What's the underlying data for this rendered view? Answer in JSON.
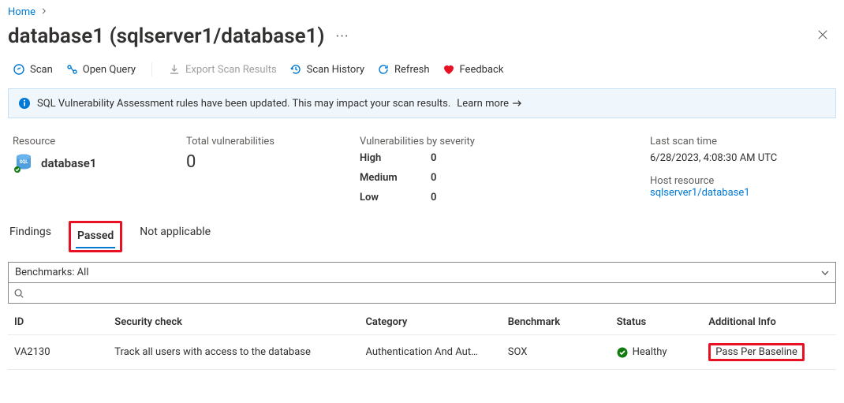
{
  "breadcrumb": {
    "home": "Home"
  },
  "title": "database1 (sqlserver1/database1)",
  "toolbar": {
    "scan": "Scan",
    "open_query": "Open Query",
    "export": "Export Scan Results",
    "history": "Scan History",
    "refresh": "Refresh",
    "feedback": "Feedback"
  },
  "banner": {
    "text": "SQL Vulnerability Assessment rules have been updated. This may impact your scan results.",
    "learn_more": "Learn more"
  },
  "summary": {
    "resource_label": "Resource",
    "resource_name": "database1",
    "total_label": "Total vulnerabilities",
    "total_value": "0",
    "severity_label": "Vulnerabilities by severity",
    "severity": {
      "high_label": "High",
      "high_value": "0",
      "medium_label": "Medium",
      "medium_value": "0",
      "low_label": "Low",
      "low_value": "0"
    },
    "scan_time_label": "Last scan time",
    "scan_time_value": "6/28/2023, 4:08:30 AM UTC",
    "host_label": "Host resource",
    "host_value": "sqlserver1/database1"
  },
  "tabs": {
    "findings": "Findings",
    "passed": "Passed",
    "na": "Not applicable"
  },
  "filter": {
    "benchmarks": "Benchmarks: All",
    "search_placeholder": ""
  },
  "table": {
    "headers": {
      "id": "ID",
      "check": "Security check",
      "category": "Category",
      "benchmark": "Benchmark",
      "status": "Status",
      "additional": "Additional Info"
    },
    "rows": [
      {
        "id": "VA2130",
        "check": "Track all users with access to the database",
        "category": "Authentication And Aut…",
        "benchmark": "SOX",
        "status": "Healthy",
        "additional": "Pass Per Baseline"
      }
    ]
  }
}
